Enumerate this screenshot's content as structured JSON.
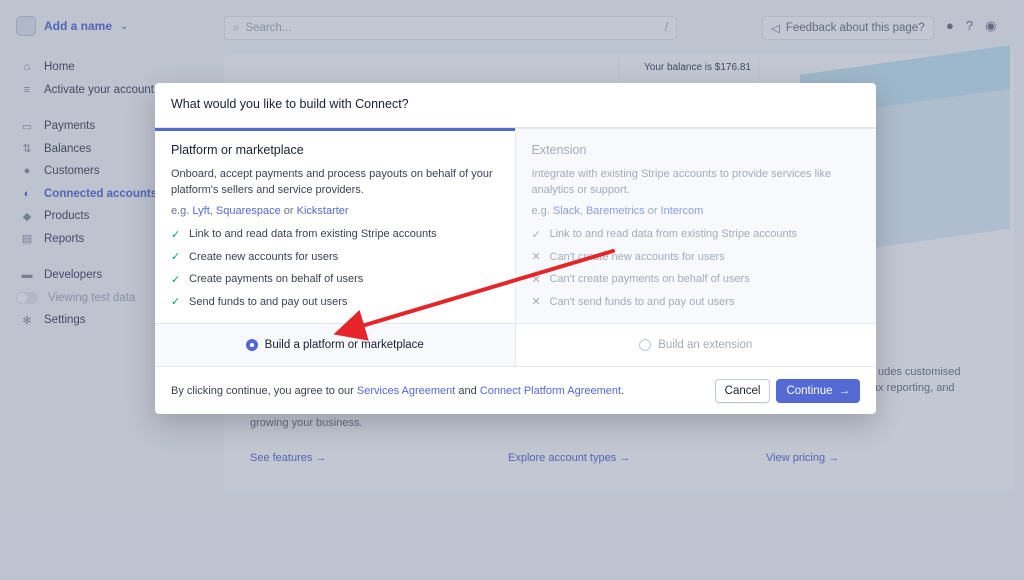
{
  "app": {
    "account_name": "Add a name",
    "search_placeholder": "Search...",
    "search_shortcut": "/",
    "feedback_label": "Feedback about this page?",
    "balance_text": "Your balance is $176.81"
  },
  "sidebar": {
    "items": [
      {
        "label": "Home",
        "icon": "home-icon"
      },
      {
        "label": "Activate your account",
        "icon": "activate-icon"
      },
      {
        "label": "Payments",
        "icon": "payments-icon"
      },
      {
        "label": "Balances",
        "icon": "balances-icon"
      },
      {
        "label": "Customers",
        "icon": "customers-icon"
      },
      {
        "label": "Connected accounts",
        "icon": "connect-icon"
      },
      {
        "label": "Products",
        "icon": "products-icon"
      },
      {
        "label": "Reports",
        "icon": "reports-icon"
      },
      {
        "label": "Developers",
        "icon": "developers-icon"
      },
      {
        "label": "Viewing test data",
        "icon": "toggle-icon"
      },
      {
        "label": "Settings",
        "icon": "gear-icon"
      }
    ]
  },
  "background": {
    "growing_text": "growing your business.",
    "includes_text": "udes customised",
    "tax_text": "ax reporting, and",
    "links": [
      "See features →",
      "Explore account types →",
      "View pricing →"
    ]
  },
  "modal": {
    "title": "What would you like to build with Connect?",
    "platform": {
      "title": "Platform or marketplace",
      "description": "Onboard, accept payments and process payouts on behalf of your platform's sellers and service providers.",
      "eg_prefix": "e.g.",
      "examples": [
        "Lyft",
        "Squarespace",
        "Kickstarter"
      ],
      "sep": ",",
      "or": "or",
      "features": [
        "Link to and read data from existing Stripe accounts",
        "Create new accounts for users",
        "Create payments on behalf of users",
        "Send funds to and pay out users"
      ],
      "option_label": "Build a platform or marketplace"
    },
    "extension": {
      "title": "Extension",
      "description": "Integrate with existing Stripe accounts to provide services like analytics or support.",
      "eg_prefix": "e.g.",
      "examples": [
        "Slack",
        "Baremetrics",
        "Intercom"
      ],
      "sep": ",",
      "or": "or",
      "features": [
        {
          "text": "Link to and read data from existing Stripe accounts",
          "supported": true
        },
        {
          "text": "Can't create new accounts for users",
          "supported": false
        },
        {
          "text": "Can't create payments on behalf of users",
          "supported": false
        },
        {
          "text": "Can't send funds to and pay out users",
          "supported": false
        }
      ],
      "option_label": "Build an extension"
    },
    "footer": {
      "prefix": "By clicking continue, you agree to our",
      "link1": "Services Agreement",
      "and": "and",
      "link2": "Connect Platform Agreement",
      "suffix": ".",
      "cancel": "Cancel",
      "continue": "Continue"
    }
  },
  "colors": {
    "accent": "#5469d4",
    "check": "#09a360",
    "arrow": "#e5252a"
  }
}
